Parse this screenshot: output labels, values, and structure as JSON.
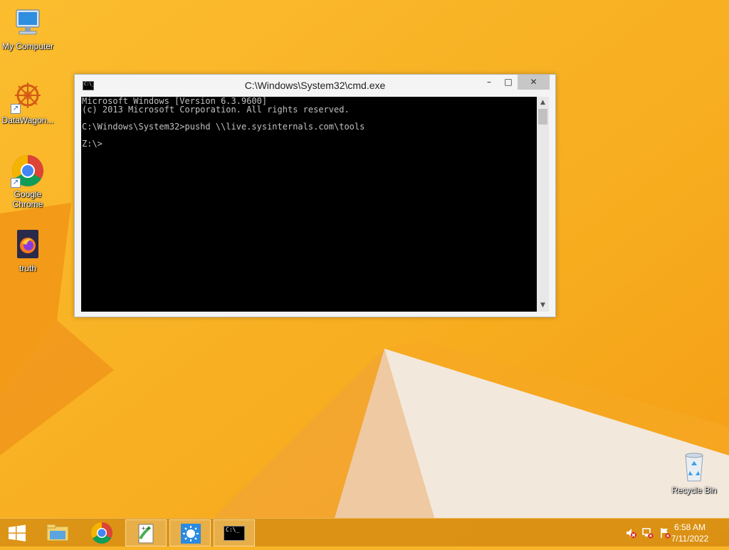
{
  "desktop": {
    "icons": [
      {
        "label": "My Computer"
      },
      {
        "label": "DataWagon..."
      },
      {
        "label": "Google Chrome"
      },
      {
        "label": "truth"
      },
      {
        "label": "Recycle Bin"
      }
    ]
  },
  "cmd_window": {
    "title": "C:\\Windows\\System32\\cmd.exe",
    "icon_text": "C:\\_",
    "controls": {
      "minimize": "–",
      "maximize": "□",
      "close": "✕"
    },
    "scroll_up": "▲",
    "scroll_down": "▼",
    "console_lines": [
      "Microsoft Windows [Version 6.3.9600]",
      "(c) 2013 Microsoft Corporation. All rights reserved.",
      "",
      "C:\\Windows\\System32>pushd \\\\live.sysinternals.com\\tools",
      "",
      "Z:\\>"
    ]
  },
  "taskbar": {
    "buttons": [
      {
        "icon": "start-windows-icon"
      },
      {
        "icon": "file-explorer-icon"
      },
      {
        "icon": "chrome-icon"
      },
      {
        "icon": "notepad-plus-plus-icon"
      },
      {
        "icon": "brightness-app-icon"
      },
      {
        "icon": "cmd-icon",
        "text": "C:\\_"
      }
    ],
    "tray": {
      "icons": [
        "volume-muted-icon",
        "network-error-icon",
        "action-center-flag-icon"
      ],
      "time": "6:58 AM",
      "date": "7/11/2022"
    }
  },
  "colors": {
    "wallpaper_orange": "#f9b428",
    "taskbar": "#d68d14",
    "console_bg": "#000000",
    "console_text": "#c0c0c0"
  }
}
